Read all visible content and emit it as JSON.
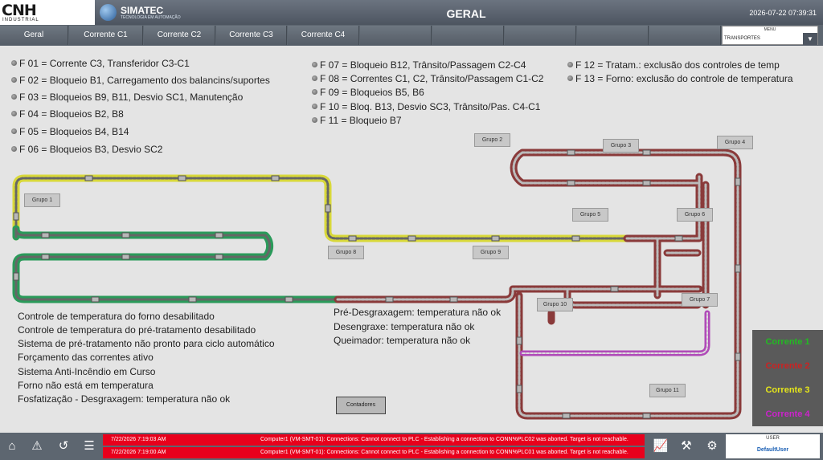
{
  "header": {
    "brand": "CNH",
    "brand_sub": "INDUSTRIAL",
    "simatec": "SIMATEC",
    "simatec_sub": "TECNOLOGIA EM AUTOMAÇÃO",
    "title": "GERAL",
    "datetime": "2026-07-22 07:39:31"
  },
  "nav": {
    "tabs": [
      "Geral",
      "Corrente C1",
      "Corrente C2",
      "Corrente C3",
      "Corrente C4"
    ],
    "menu_label": "MENU",
    "menu_selected": "TRANSPORTES"
  },
  "faults": [
    "F 01 = Corrente C3, Transferidor C3-C1",
    "F 02 = Bloqueio B1, Carregamento dos balancins/suportes",
    "F 03 = Bloqueios B9, B11, Desvio SC1, Manutenção",
    "F 04 = Bloqueios B2, B8",
    "F 05 = Bloqueios B4, B14",
    "F 06 = Bloqueios B3, Desvio SC2",
    "F 07 = Bloqueio B12, Trânsito/Passagem C2-C4",
    "F 08 = Correntes C1, C2, Trânsito/Passagem C1-C2",
    "F 09 = Bloqueios B5, B6",
    "F 10 = Bloq. B13, Desvio SC3, Trânsito/Pas. C4-C1",
    "F 11 = Bloqueio B7",
    "F 12 = Tratam.: exclusão dos controles de temp",
    "F 13 = Forno: exclusão do controle de temperatura"
  ],
  "groups": [
    "Grupo 1",
    "Grupo 2",
    "Grupo 3",
    "Grupo 4",
    "Grupo 5",
    "Grupo 6",
    "Grupo 7",
    "Grupo 8",
    "Grupo 9",
    "Grupo 10",
    "Grupo 11"
  ],
  "status_left": [
    "Controle de temperatura do forno desabilitado",
    "Controle de temperatura do pré-tratamento desabilitado",
    "Sistema de pré-tratamento não pronto para ciclo automático",
    "Forçamento das correntes ativo",
    "Sistema Anti-Incêndio em Curso",
    "Forno não está em temperatura",
    "Fosfatização - Desgraxagem: temperatura não ok"
  ],
  "status_right": [
    "Pré-Desgraxagem: temperatura não ok",
    "Desengraxe: temperatura não ok",
    "Queimador: temperatura não ok"
  ],
  "contadores_label": "Contadores",
  "legend": [
    {
      "label": "Corrente 1",
      "color": "#22bb22"
    },
    {
      "label": "Corrente 2",
      "color": "#cc2222"
    },
    {
      "label": "Corrente 3",
      "color": "#e6e61a"
    },
    {
      "label": "Corrente 4",
      "color": "#cc22cc"
    }
  ],
  "track_colors": {
    "c1": "#2a9a5a",
    "c2": "#8a3a3a",
    "c3": "#d8d83a",
    "c4": "#b04ab8"
  },
  "alarms": [
    {
      "time": "7/22/2026 7:19:03 AM",
      "text": "Computer1 (VM-SMT-01): Connections: Cannot connect to PLC - Establishing a connection to CONN%PLC02 was aborted. Target is not reachable."
    },
    {
      "time": "7/22/2026 7:19:00 AM",
      "text": "Computer1 (VM-SMT-01): Connections: Cannot connect to PLC - Establishing a connection to CONN%PLC01 was aborted. Target is not reachable."
    }
  ],
  "user": {
    "label": "USER",
    "name": "DefaultUser"
  }
}
